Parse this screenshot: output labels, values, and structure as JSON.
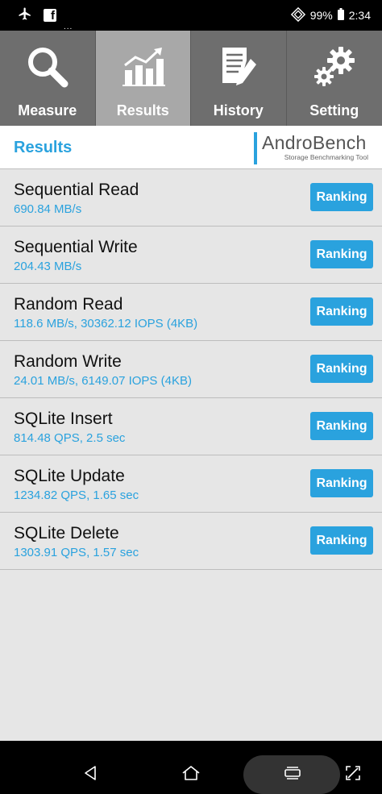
{
  "status_bar": {
    "battery": "99%",
    "time": "2:34",
    "icons": [
      "airplane-icon",
      "facebook-icon",
      "signal-icon",
      "battery-icon"
    ]
  },
  "tabs": [
    {
      "label": "Measure",
      "icon": "magnifier-icon",
      "active": false
    },
    {
      "label": "Results",
      "icon": "bar-chart-icon",
      "active": true
    },
    {
      "label": "History",
      "icon": "document-pencil-icon",
      "active": false
    },
    {
      "label": "Setting",
      "icon": "gears-icon",
      "active": false
    }
  ],
  "header": {
    "title": "Results",
    "logo_text": "AndroBench",
    "logo_subtitle": "Storage Benchmarking Tool"
  },
  "results": [
    {
      "name": "Sequential Read",
      "value": "690.84 MB/s",
      "button": "Ranking"
    },
    {
      "name": "Sequential Write",
      "value": "204.43 MB/s",
      "button": "Ranking"
    },
    {
      "name": "Random Read",
      "value": "118.6 MB/s, 30362.12 IOPS (4KB)",
      "button": "Ranking"
    },
    {
      "name": "Random Write",
      "value": "24.01 MB/s, 6149.07 IOPS (4KB)",
      "button": "Ranking"
    },
    {
      "name": "SQLite Insert",
      "value": "814.48 QPS, 2.5 sec",
      "button": "Ranking"
    },
    {
      "name": "SQLite Update",
      "value": "1234.82 QPS, 1.65 sec",
      "button": "Ranking"
    },
    {
      "name": "SQLite Delete",
      "value": "1303.91 QPS, 1.57 sec",
      "button": "Ranking"
    }
  ],
  "nav_bar": {
    "buttons": [
      "back-icon",
      "home-icon",
      "recents-icon",
      "expand-icon"
    ]
  },
  "colors": {
    "accent": "#2aa2de",
    "tab_bg": "#6e6e6e",
    "tab_active_bg": "#a8a8a8",
    "list_bg": "#e6e6e6"
  }
}
